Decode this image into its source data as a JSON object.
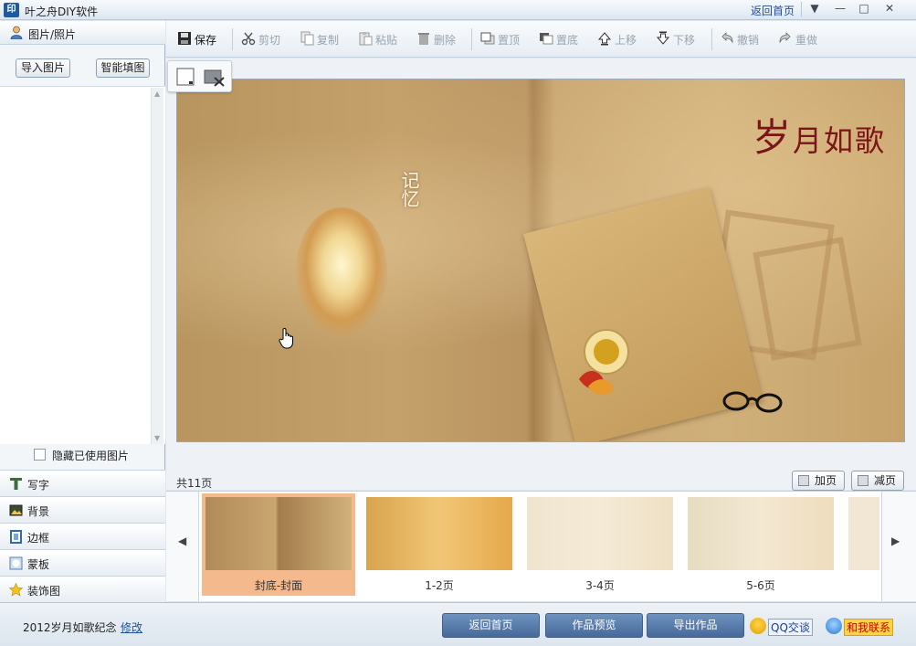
{
  "window": {
    "app_icon": "印",
    "title": "叶之舟DIY软件",
    "home_link": "返回首页",
    "controls": [
      "▼",
      "—",
      "□",
      "✕"
    ]
  },
  "left_panel": {
    "header": "图片/照片",
    "import_button": "导入图片",
    "smart_fill_button": "智能填图",
    "hide_used_label": "隐藏已使用图片",
    "hide_used_checked": false,
    "tools": [
      "写字",
      "背景",
      "边框",
      "蒙板",
      "装饰图"
    ]
  },
  "toolbar": {
    "save": "保存",
    "cut": "剪切",
    "copy": "复制",
    "paste": "粘贴",
    "delete": "删除",
    "bring_top": "置顶",
    "send_bottom": "置底",
    "move_up": "上移",
    "move_down": "下移",
    "undo": "撤销",
    "redo": "重做"
  },
  "canvas": {
    "cover_title_big": "岁",
    "cover_title_rest": "月如歌",
    "vertical_text": "记忆"
  },
  "pages": {
    "count_label": "共11页",
    "add_page": "加页",
    "remove_page": "减页",
    "thumbnails": [
      "封底-封面",
      "1-2页",
      "3-4页",
      "5-6页"
    ],
    "selected_index": 0
  },
  "status": {
    "album_name": "2012岁月如歌纪念",
    "edit_link": "修改",
    "back_home": "返回首页",
    "preview": "作品预览",
    "export": "导出作品",
    "qq_chat": "QQ交谈",
    "contact": "和我联系"
  },
  "colors": {
    "accent": "#46699a",
    "selected_thumb": "#f4b98c",
    "title_red": "#7a1419"
  }
}
